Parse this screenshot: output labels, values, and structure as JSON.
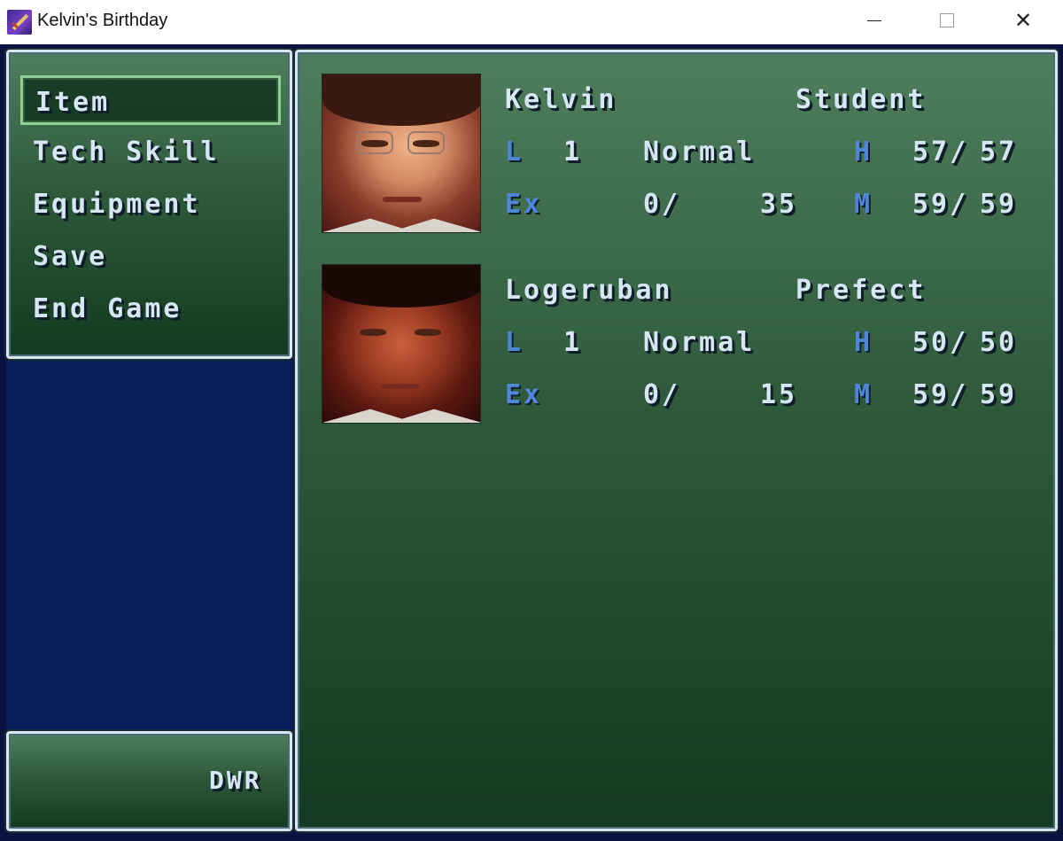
{
  "window": {
    "title": "Kelvin's Birthday",
    "icon": "sword-icon",
    "minimize_icon": "minimize-icon",
    "maximize_icon": "maximize-icon",
    "close_icon": "close-icon",
    "close_glyph": "✕"
  },
  "menu": {
    "items": [
      {
        "label": "Item",
        "selected": true
      },
      {
        "label": "Tech Skill",
        "selected": false
      },
      {
        "label": "Equipment",
        "selected": false
      },
      {
        "label": "Save",
        "selected": false
      },
      {
        "label": "End Game",
        "selected": false
      }
    ]
  },
  "gold": {
    "label": "DWR"
  },
  "party": [
    {
      "name": "Kelvin",
      "class": "Student",
      "level_label": "L",
      "level": "1",
      "state": "Normal",
      "hp_label": "H",
      "hp": "57/",
      "hp_max": "57",
      "exp_label": "Ex",
      "exp": "0/",
      "exp_next": "35",
      "mp_label": "M",
      "mp": "59/",
      "mp_max": "59"
    },
    {
      "name": "Logeruban",
      "class": "Prefect",
      "level_label": "L",
      "level": "1",
      "state": "Normal",
      "hp_label": "H",
      "hp": "50/",
      "hp_max": "50",
      "exp_label": "Ex",
      "exp": "0/",
      "exp_next": "15",
      "mp_label": "M",
      "mp": "59/",
      "mp_max": "59"
    }
  ],
  "colors": {
    "window_top": "#4f7e5d",
    "window_bottom": "#133a20",
    "side_panel": "#061e5c",
    "label_blue": "#4f86d8",
    "text": "#d6e6f2"
  }
}
